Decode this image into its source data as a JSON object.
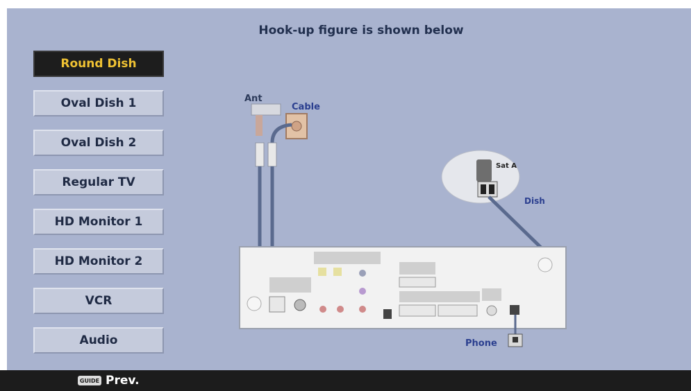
{
  "header": {
    "title": "Hook-up figure is shown below"
  },
  "menu": {
    "items": [
      {
        "label": "Round Dish",
        "selected": true
      },
      {
        "label": "Oval Dish 1",
        "selected": false
      },
      {
        "label": "Oval Dish 2",
        "selected": false
      },
      {
        "label": "Regular TV",
        "selected": false
      },
      {
        "label": "HD Monitor 1",
        "selected": false
      },
      {
        "label": "HD Monitor 2",
        "selected": false
      },
      {
        "label": "VCR",
        "selected": false
      },
      {
        "label": "Audio",
        "selected": false
      }
    ]
  },
  "diagram": {
    "ant_label": "Ant",
    "cable_label": "Cable",
    "sat_label": "Sat A",
    "dish_label": "Dish",
    "phone_label": "Phone"
  },
  "footer": {
    "prev_key": "GUIDE",
    "prev_label": "Prev."
  },
  "colors": {
    "background": "#a9b3cf",
    "selected_bg": "#1d1d1d",
    "selected_text": "#f0c233",
    "title_text": "#22304f",
    "button_bg": "#c5cbdc",
    "cable_blue": "#5a6a8e",
    "bottom_bar": "#1c1c1c"
  }
}
